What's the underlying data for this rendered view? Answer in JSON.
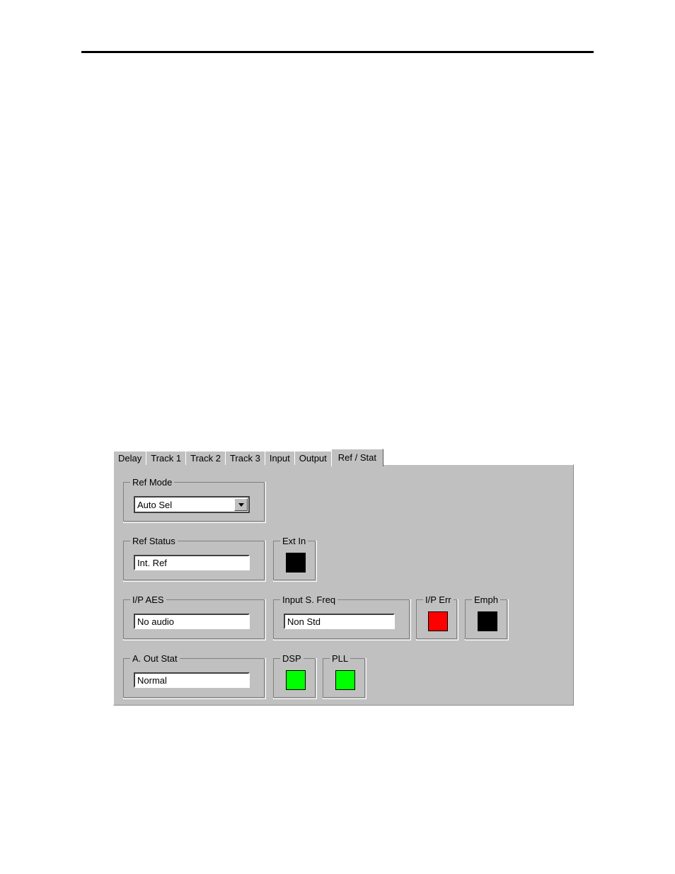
{
  "page": {
    "header_rule": true
  },
  "dialog": {
    "tabs": [
      {
        "label": "Delay",
        "active": false
      },
      {
        "label": "Track 1",
        "active": false
      },
      {
        "label": "Track 2",
        "active": false
      },
      {
        "label": "Track 3",
        "active": false
      },
      {
        "label": "Input",
        "active": false
      },
      {
        "label": "Output",
        "active": false
      },
      {
        "label": "Ref / Stat",
        "active": true
      }
    ],
    "groups": {
      "ref_mode": {
        "label": "Ref Mode",
        "combo": {
          "value": "Auto Sel",
          "options": [
            "Auto Sel"
          ]
        }
      },
      "ref_status": {
        "label": "Ref Status",
        "value": "Int. Ref"
      },
      "ext_in": {
        "label": "Ext In",
        "led_color": "#000000",
        "led_state": "off"
      },
      "ip_aes": {
        "label": "I/P AES",
        "value": "No audio"
      },
      "input_s_freq": {
        "label": "Input S. Freq",
        "value": "Non Std"
      },
      "ip_err": {
        "label": "I/P Err",
        "led_color": "#ff0000",
        "led_state": "on"
      },
      "emph": {
        "label": "Emph",
        "led_color": "#000000",
        "led_state": "off"
      },
      "a_out_stat": {
        "label": "A. Out Stat",
        "value": "Normal"
      },
      "dsp": {
        "label": "DSP",
        "led_color": "#00ff00",
        "led_state": "on"
      },
      "pll": {
        "label": "PLL",
        "led_color": "#00ff00",
        "led_state": "on"
      }
    }
  },
  "colors": {
    "face": "#c0c0c0",
    "shadow": "#808080",
    "highlight": "#ffffff",
    "dark": "#404040",
    "led_on_green": "#00ff00",
    "led_on_red": "#ff0000",
    "led_off": "#000000"
  }
}
